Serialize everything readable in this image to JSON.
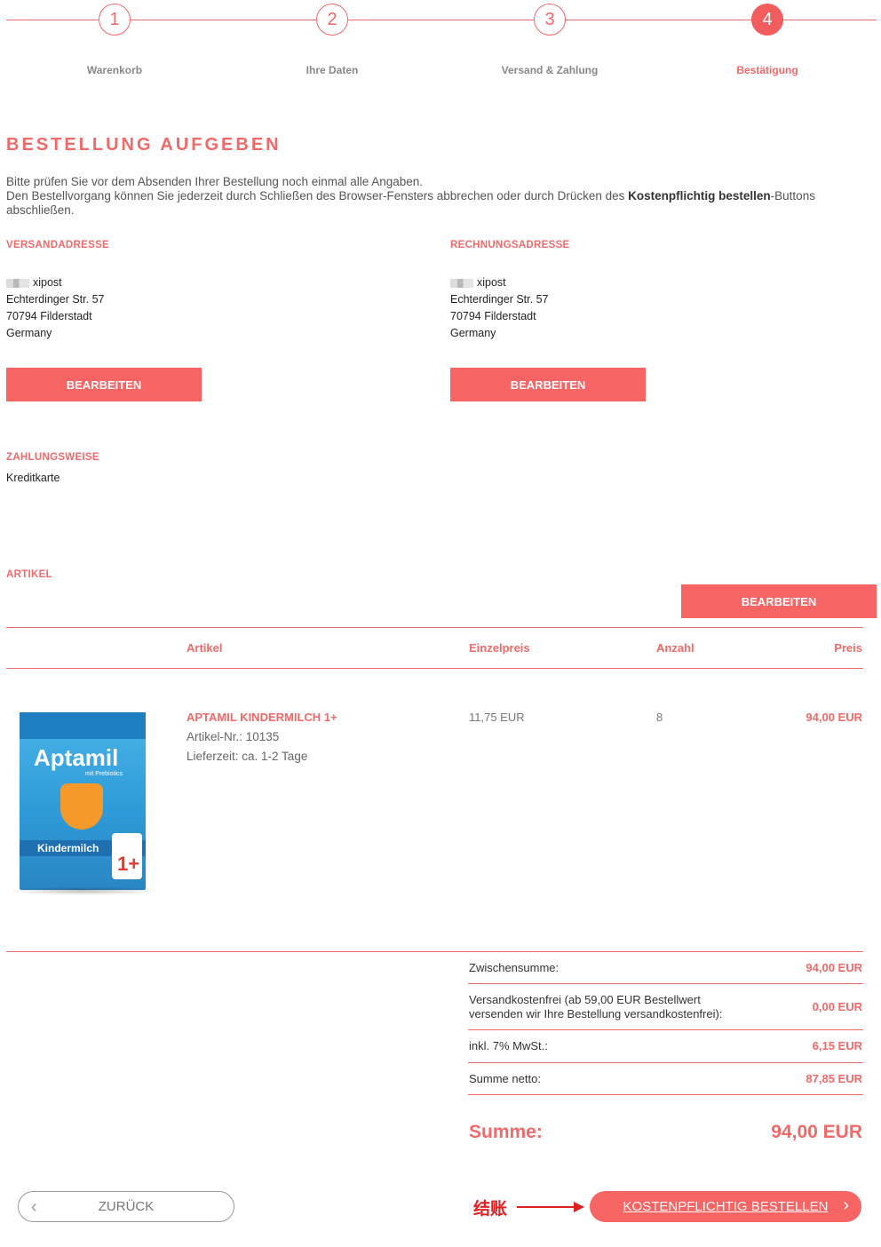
{
  "stepper": {
    "steps": [
      {
        "number": "1",
        "label": "Warenkorb"
      },
      {
        "number": "2",
        "label": "Ihre Daten"
      },
      {
        "number": "3",
        "label": "Versand & Zahlung"
      },
      {
        "number": "4",
        "label": "Bestätigung"
      }
    ],
    "active_step": 4
  },
  "page_title": "BESTELLUNG AUFGEBEN",
  "intro": {
    "line1": "Bitte prüfen Sie vor dem Absenden Ihrer Bestellung noch einmal alle Angaben.",
    "line2_pre": "Den Bestellvorgang können Sie jederzeit durch Schließen des Browser-Fensters abbrechen oder durch Drücken des ",
    "line2_bold": "Kostenpflichtig bestellen",
    "line2_post": "-Buttons abschließen."
  },
  "shipping": {
    "heading": "VERSANDADRESSE",
    "name": "xipost",
    "street": "Echterdinger Str. 57",
    "city": "70794 Filderstadt",
    "country": "Germany",
    "edit_label": "BEARBEITEN"
  },
  "billing": {
    "heading": "RECHNUNGSADRESSE",
    "name": "xipost",
    "street": "Echterdinger Str. 57",
    "city": "70794 Filderstadt",
    "country": "Germany",
    "edit_label": "BEARBEITEN"
  },
  "payment": {
    "heading": "ZAHLUNGSWEISE",
    "method": "Kreditkarte"
  },
  "articles": {
    "heading": "ARTIKEL",
    "edit_label": "BEARBEITEN",
    "columns": {
      "article": "Artikel",
      "unit_price": "Einzelpreis",
      "quantity": "Anzahl",
      "price": "Preis"
    },
    "items": [
      {
        "name": "APTAMIL KINDERMILCH 1+",
        "article_no": "Artikel-Nr.: 10135",
        "delivery": "Lieferzeit: ca. 1-2 Tage",
        "unit_price": "11,75 EUR",
        "quantity": "8",
        "price": "94,00 EUR",
        "image": {
          "brand": "Aptamil",
          "sub": "mit Prebiotics",
          "band": "Kindermilch",
          "badge": "1+"
        }
      }
    ]
  },
  "summary": {
    "rows": [
      {
        "label": "Zwischensumme:",
        "value": "94,00 EUR"
      },
      {
        "label": "Versandkostenfrei (ab 59,00 EUR Bestellwert versenden wir Ihre Bestellung versandkostenfrei):",
        "value": "0,00 EUR"
      },
      {
        "label": "inkl. 7% MwSt.:",
        "value": "6,15 EUR"
      },
      {
        "label": "Summe netto:",
        "value": "87,85 EUR"
      }
    ],
    "total_label": "Summe:",
    "total_value": "94,00 EUR"
  },
  "footer": {
    "back_label": "ZURÜCK",
    "order_label": "KOSTENPFLICHTIG BESTELLEN",
    "annotation": "结账"
  },
  "colors": {
    "accent": "#f06a6a",
    "button": "#f76464",
    "annotation": "#e02020"
  }
}
